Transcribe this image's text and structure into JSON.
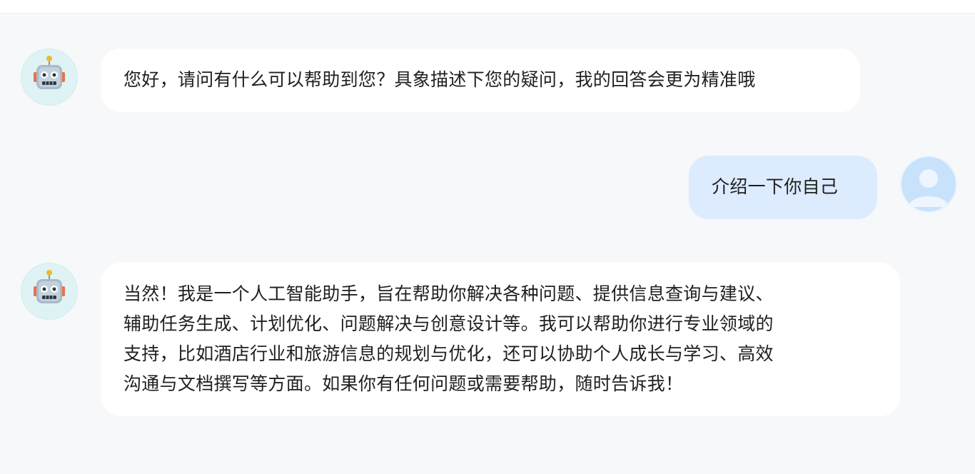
{
  "messages": [
    {
      "role": "assistant",
      "avatar_icon": "robot-icon",
      "text": "您好，请问有什么可以帮助到您？具象描述下您的疑问，我的回答会更为精准哦"
    },
    {
      "role": "user",
      "avatar_icon": "user-avatar-icon",
      "text": "介绍一下你自己"
    },
    {
      "role": "assistant",
      "avatar_icon": "robot-icon",
      "lines": [
        "当然！我是一个人工智能助手，旨在帮助你解决各种问题、提供信息查询与建议、",
        "辅助任务生成、计划优化、问题解决与创意设计等。我可以帮助你进行专业领域的",
        "支持，比如酒店行业和旅游信息的规划与优化，还可以协助个人成长与学习、高效",
        "沟通与文档撰写等方面。如果你有任何问题或需要帮助，随时告诉我！"
      ]
    }
  ],
  "colors": {
    "page_background": "#f7f8fa",
    "assistant_bubble": "#ffffff",
    "user_bubble": "#dcebfd",
    "bot_avatar_bg": "#dff3f5",
    "user_avatar_bg": "#c9e2fb"
  }
}
